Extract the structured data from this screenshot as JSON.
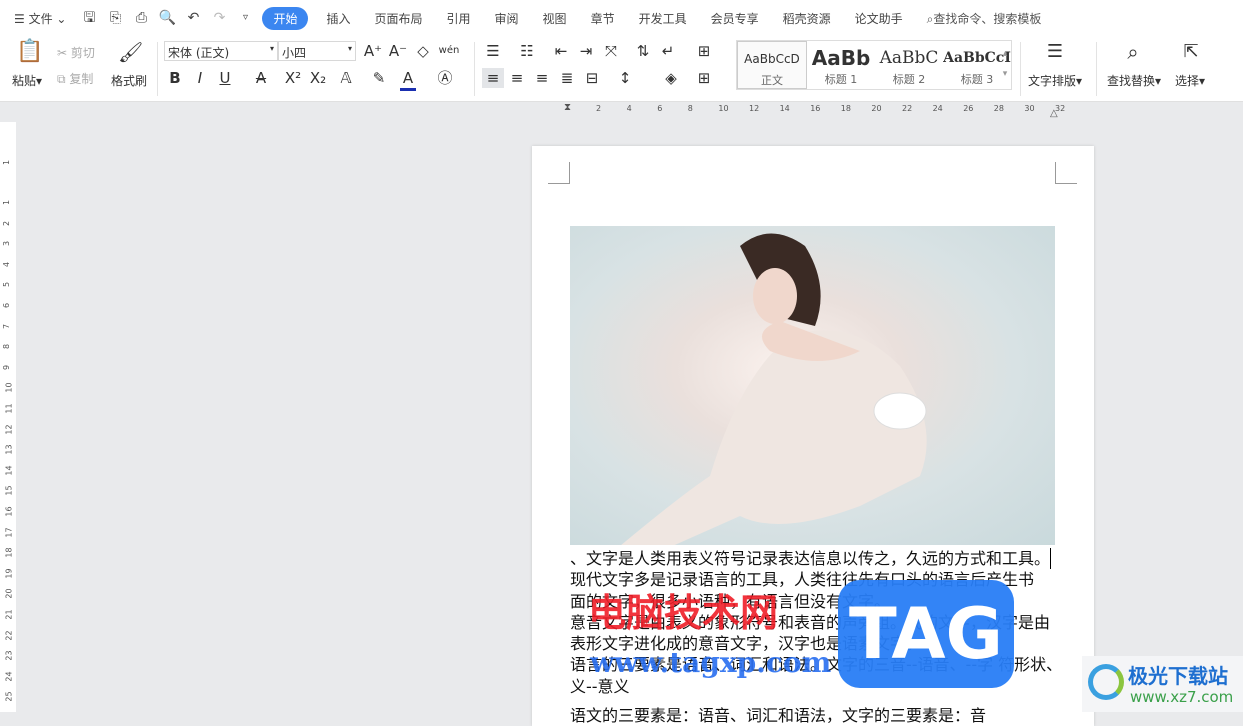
{
  "menubar": {
    "file": "文件",
    "tabs": [
      "开始",
      "插入",
      "页面布局",
      "引用",
      "审阅",
      "视图",
      "章节",
      "开发工具",
      "会员专享",
      "稻壳资源",
      "论文助手"
    ],
    "search": "查找命令、搜索模板"
  },
  "ribbon": {
    "paste": "粘贴",
    "cut": "剪切",
    "copy": "复制",
    "format_painter": "格式刷",
    "font": "宋体 (正文)",
    "size": "小四",
    "wen": "wén",
    "styles": [
      {
        "sample": "AaBbCcD",
        "label": "正文"
      },
      {
        "sample": "AaBb",
        "label": "标题 1"
      },
      {
        "sample": "AaBbC",
        "label": "标题 2"
      },
      {
        "sample": "AaBbCcI",
        "label": "标题 3"
      }
    ],
    "text_layout": "文字排版",
    "find_replace": "查找替换",
    "select": "选择"
  },
  "ruler": {
    "h": [
      "2",
      "4",
      "6",
      "8",
      "10",
      "12",
      "14",
      "16",
      "18",
      "20",
      "22",
      "24",
      "26",
      "28",
      "30",
      "32"
    ],
    "v": [
      "1",
      "1",
      "2",
      "3",
      "4",
      "5",
      "6",
      "7",
      "8",
      "9",
      "10",
      "11",
      "12",
      "13",
      "14",
      "15",
      "16",
      "17",
      "18",
      "19",
      "20",
      "21",
      "22",
      "23",
      "24",
      "25"
    ]
  },
  "document": {
    "lines": [
      "、文字是人类用表义符号记录表达信息以传之，久远的方式和工具。",
      "现代文字多是记录语言的工具，人类往往先有口头的语言后产生书",
      "面的文字，很多小语种，有语言但没有文字。",
      "意音文字是由表义的象形符号和表音的声旁组。成的文字，汉字是由",
      "表形文字进化成的意音文字，汉字也是语素文字。",
      "语言的三要素是语音、词汇和语法。文字的三音--语音、--字 符形状、",
      "义--意义",
      "语文的三要素是：语音、词汇和语法，文字的三要素是：音"
    ]
  },
  "watermark": {
    "cn": "电脑技术网",
    "url": "www.tagxp.com",
    "tag": "TAG",
    "site_cn": "极光下载站",
    "site_url": "www.xz7.com"
  },
  "colors": {
    "accent": "#3b86f0"
  }
}
